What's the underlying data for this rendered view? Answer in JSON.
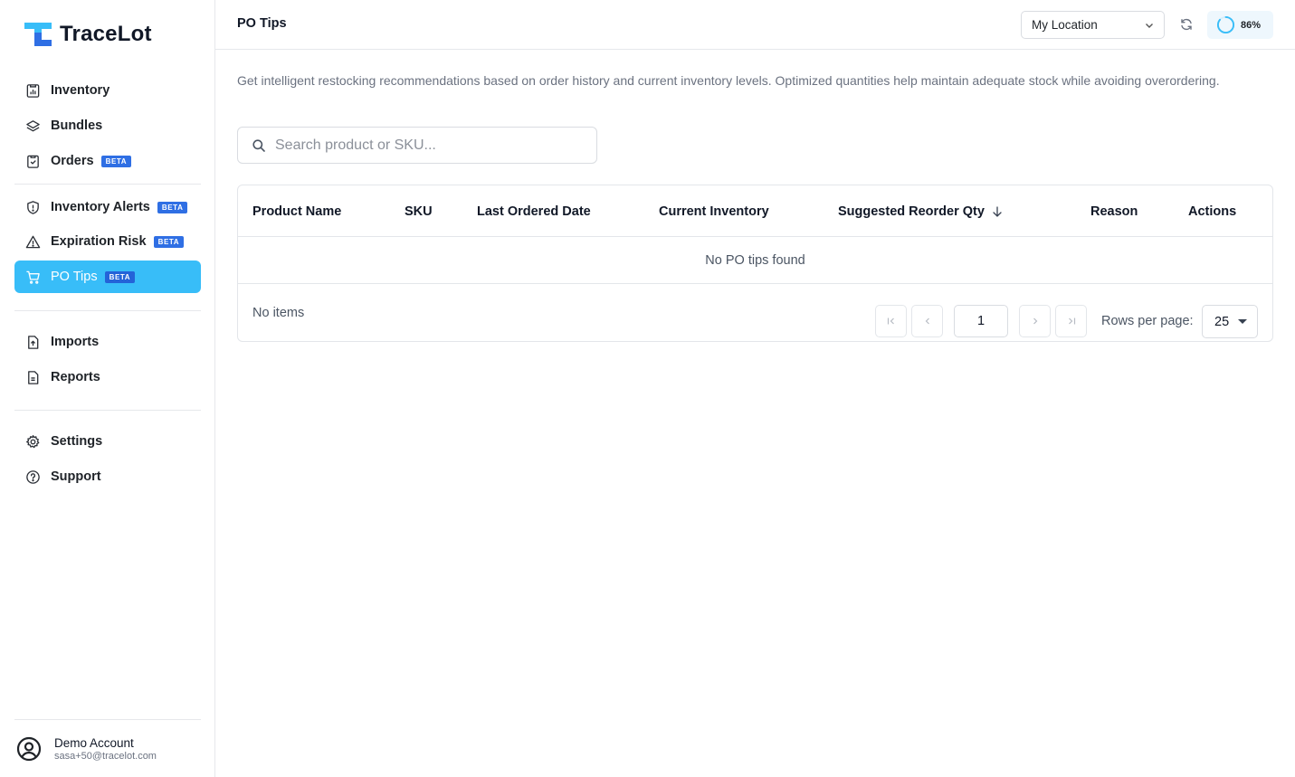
{
  "brand": {
    "name": "TraceLot",
    "accent": "#38bdf8",
    "logo_colors": [
      "#38bdf8",
      "#2f6fe4"
    ]
  },
  "sidebar": {
    "items": [
      {
        "label": "Inventory",
        "icon": "inventory-icon",
        "badge": ""
      },
      {
        "label": "Bundles",
        "icon": "layers-icon",
        "badge": ""
      },
      {
        "label": "Orders",
        "icon": "clipboard-icon",
        "badge": "BETA"
      },
      {
        "label": "Inventory Alerts",
        "icon": "shield-alert-icon",
        "badge": "BETA"
      },
      {
        "label": "Expiration Risk",
        "icon": "warning-triangle-icon",
        "badge": "BETA"
      },
      {
        "label": "PO Tips",
        "icon": "cart-icon",
        "badge": "BETA",
        "active": true
      },
      {
        "label": "Imports",
        "icon": "file-import-icon",
        "badge": ""
      },
      {
        "label": "Reports",
        "icon": "file-report-icon",
        "badge": ""
      },
      {
        "label": "Settings",
        "icon": "gear-icon",
        "badge": ""
      },
      {
        "label": "Support",
        "icon": "help-circle-icon",
        "badge": ""
      }
    ],
    "account": {
      "name": "Demo Account",
      "email": "sasa+50@tracelot.com"
    }
  },
  "header": {
    "title": "PO Tips",
    "location": {
      "selected": "My Location"
    },
    "progress": {
      "value": 86,
      "label": "86%"
    }
  },
  "main": {
    "intro": "Get intelligent restocking recommendations based on order history and current inventory levels. Optimized quantities help maintain adequate stock while avoiding overordering.",
    "search": {
      "placeholder": "Search product or SKU...",
      "value": ""
    },
    "table": {
      "columns": [
        "Product Name",
        "SKU",
        "Last Ordered Date",
        "Current Inventory",
        "Suggested Reorder Qty",
        "Reason",
        "Actions"
      ],
      "sorted_column": "Suggested Reorder Qty",
      "sort_direction": "desc",
      "empty_message": "No PO tips found",
      "rows": []
    },
    "pagination": {
      "items_text": "No items",
      "current_page": "1",
      "rows_per_page_label": "Rows per page:",
      "rows_per_page": "25"
    }
  }
}
